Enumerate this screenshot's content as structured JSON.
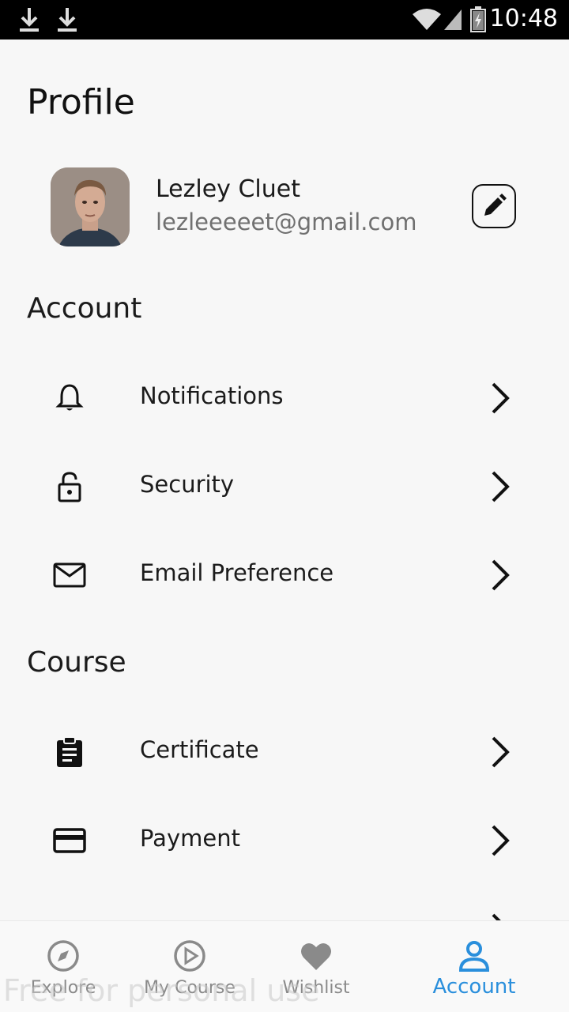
{
  "status_bar": {
    "time": "10:48",
    "icons": [
      "download-icon",
      "download-icon",
      "wifi-icon",
      "signal-icon",
      "battery-charging-icon"
    ]
  },
  "page": {
    "title": "Profile"
  },
  "profile": {
    "name": "Lezley Cluet",
    "email": "lezleeeeet@gmail.com",
    "edit_icon": "pencil-icon"
  },
  "sections": {
    "account": {
      "title": "Account",
      "items": [
        {
          "label": "Notifications",
          "icon": "bell-icon"
        },
        {
          "label": "Security",
          "icon": "lock-icon"
        },
        {
          "label": "Email Preference",
          "icon": "mail-icon"
        }
      ]
    },
    "course": {
      "title": "Course",
      "items": [
        {
          "label": "Certificate",
          "icon": "clipboard-icon"
        },
        {
          "label": "Payment",
          "icon": "credit-card-icon"
        }
      ]
    }
  },
  "bottom_nav": {
    "items": [
      {
        "label": "Explore",
        "icon": "compass-icon"
      },
      {
        "label": "My Course",
        "icon": "play-circle-icon"
      },
      {
        "label": "Wishlist",
        "icon": "heart-icon"
      },
      {
        "label": "Account",
        "icon": "user-icon",
        "active": true
      }
    ]
  },
  "colors": {
    "accent": "#2a8fdc",
    "text": "#1b1b1b",
    "muted": "#707070",
    "background": "#f7f7f7"
  },
  "watermark": "Free for personal use"
}
